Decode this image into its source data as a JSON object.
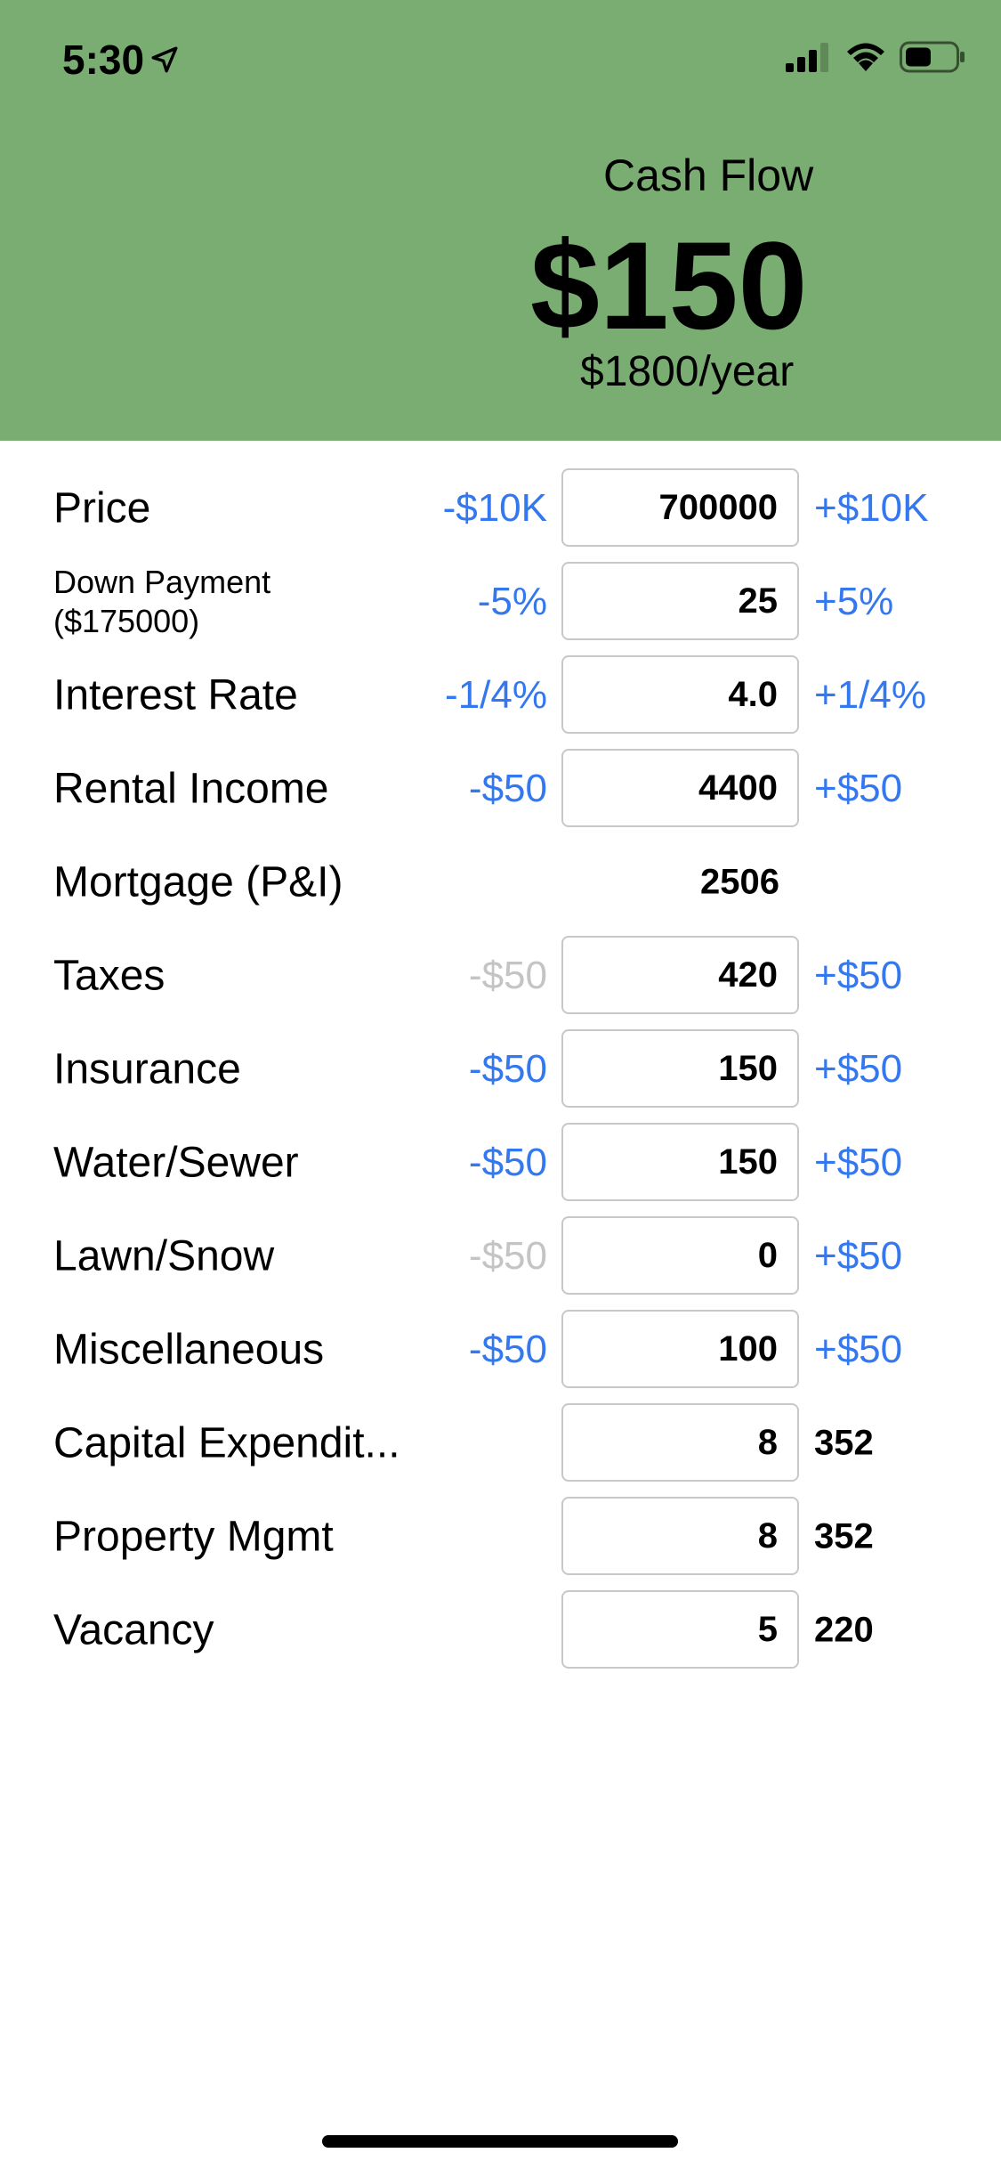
{
  "status": {
    "time": "5:30"
  },
  "header": {
    "title": "Cash Flow",
    "amount": "$150",
    "yearly": "$1800/year",
    "bg_color": "#7aad71"
  },
  "rows": [
    {
      "label": "Price",
      "minus": "-$10K",
      "value": "700000",
      "plus": "+$10K"
    },
    {
      "label_line1": "Down Payment",
      "label_line2": "($175000)",
      "minus": "-5%",
      "value": "25",
      "plus": "+5%"
    },
    {
      "label": "Interest Rate",
      "minus": "-1/4%",
      "value": "4.0",
      "plus": "+1/4%"
    },
    {
      "label": "Rental Income",
      "minus": "-$50",
      "value": "4400",
      "plus": "+$50"
    },
    {
      "label": "Mortgage (P&I)",
      "value": "2506"
    },
    {
      "label": "Taxes",
      "minus": "-$50",
      "value": "420",
      "plus": "+$50",
      "minus_disabled": true
    },
    {
      "label": "Insurance",
      "minus": "-$50",
      "value": "150",
      "plus": "+$50"
    },
    {
      "label": "Water/Sewer",
      "minus": "-$50",
      "value": "150",
      "plus": "+$50"
    },
    {
      "label": "Lawn/Snow",
      "minus": "-$50",
      "value": "0",
      "plus": "+$50",
      "minus_disabled": true
    },
    {
      "label": "Miscellaneous",
      "minus": "-$50",
      "value": "100",
      "plus": "+$50"
    },
    {
      "label": "Capital Expendit...",
      "value": "8",
      "computed": "352"
    },
    {
      "label": "Property Mgmt",
      "value": "8",
      "computed": "352"
    },
    {
      "label": "Vacancy",
      "value": "5",
      "computed": "220"
    }
  ],
  "colors": {
    "accent": "#3478f0",
    "disabled": "#c4c4c4"
  }
}
